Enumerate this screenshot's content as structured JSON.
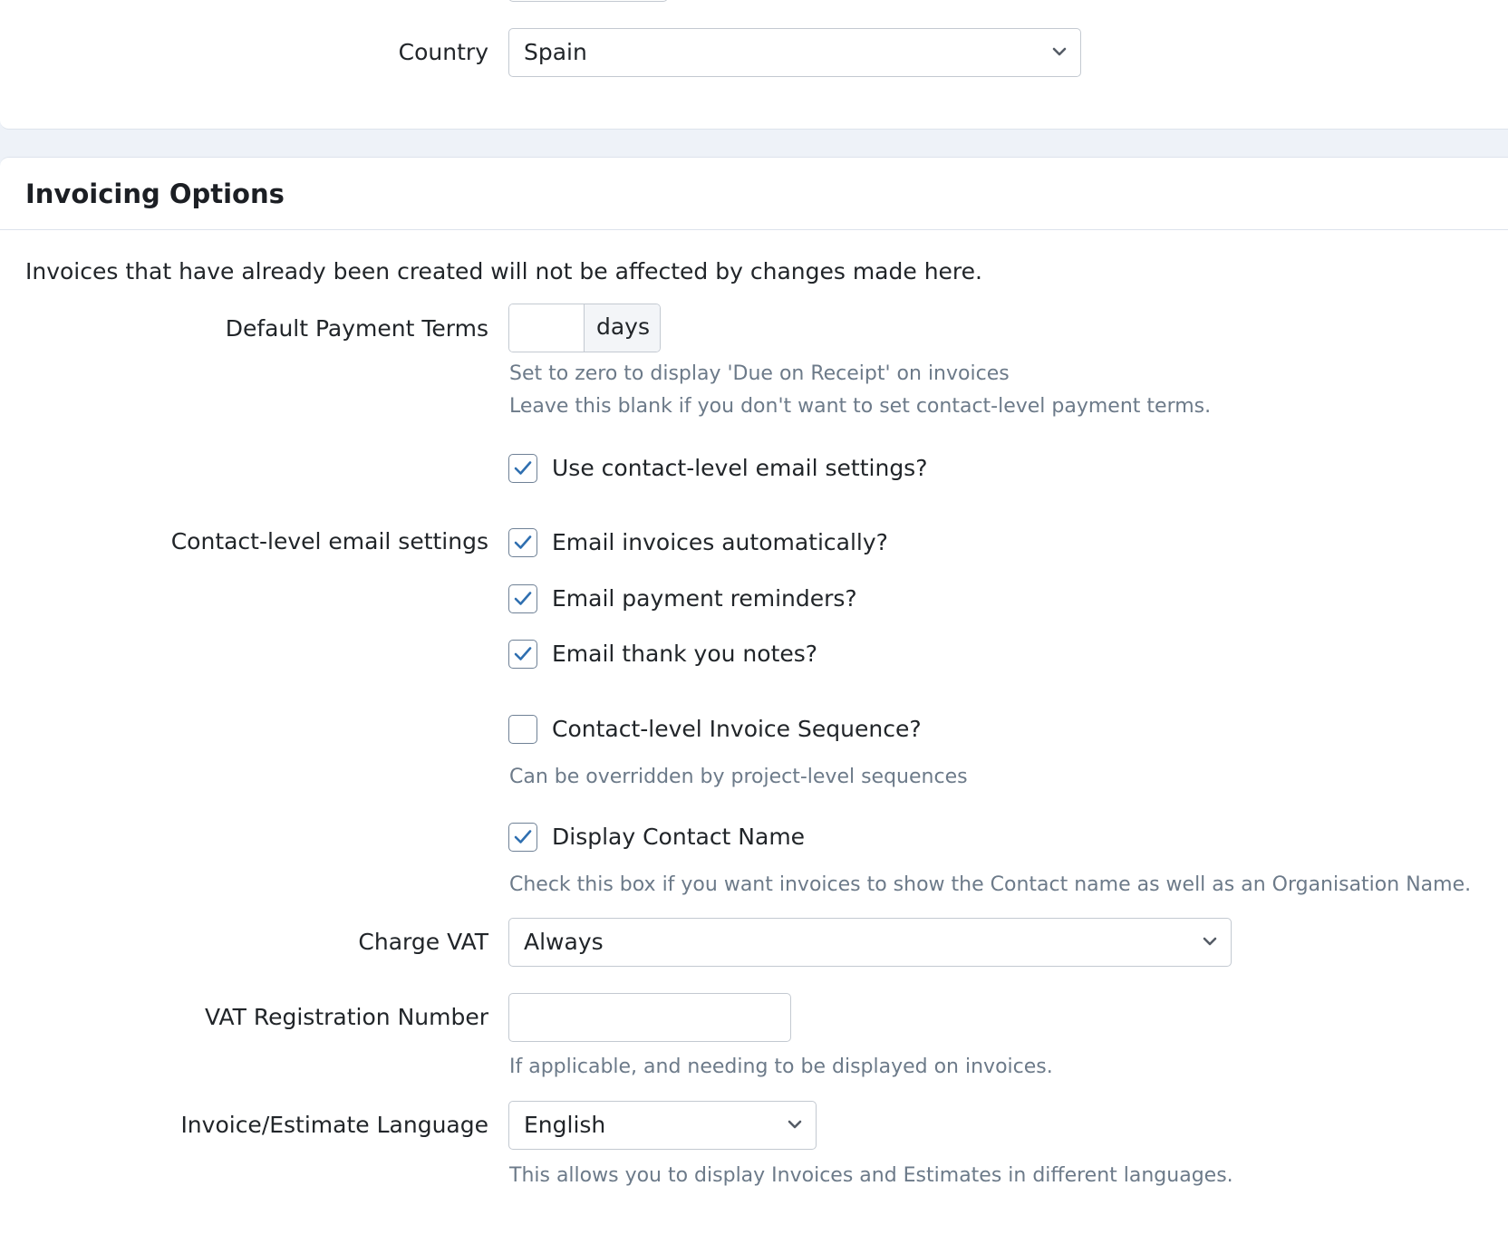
{
  "address": {
    "country_label": "Country",
    "country_value": "Spain"
  },
  "invoicing": {
    "title": "Invoicing Options",
    "intro": "Invoices that have already been created will not be affected by changes made here.",
    "payment_terms": {
      "label": "Default Payment Terms",
      "value": "",
      "unit": "days",
      "help_1": "Set to zero to display 'Due on Receipt' on invoices",
      "help_2": "Leave this blank if you don't want to set contact-level payment terms."
    },
    "use_contact_email": {
      "label": "Use contact-level email settings?",
      "checked": true
    },
    "email_settings": {
      "label": "Contact-level email settings",
      "options": [
        {
          "label": "Email invoices automatically?",
          "checked": true
        },
        {
          "label": "Email payment reminders?",
          "checked": true
        },
        {
          "label": "Email thank you notes?",
          "checked": true
        }
      ]
    },
    "invoice_sequence": {
      "label": "Contact-level Invoice Sequence?",
      "checked": false,
      "help": "Can be overridden by project-level sequences"
    },
    "display_contact_name": {
      "label": "Display Contact Name",
      "checked": true,
      "help": "Check this box if you want invoices to show the Contact name as well as an Organisation Name."
    },
    "charge_vat": {
      "label": "Charge VAT",
      "value": "Always"
    },
    "vat_number": {
      "label": "VAT Registration Number",
      "value": "",
      "help": "If applicable, and needing to be displayed on invoices."
    },
    "language": {
      "label": "Invoice/Estimate Language",
      "value": "English",
      "help": "This allows you to display Invoices and Estimates in different languages."
    }
  },
  "colors": {
    "check": "#2f6fb0",
    "border": "#c3c9d1",
    "help_text": "#6c7a89",
    "page_bg": "#eef2f8"
  }
}
